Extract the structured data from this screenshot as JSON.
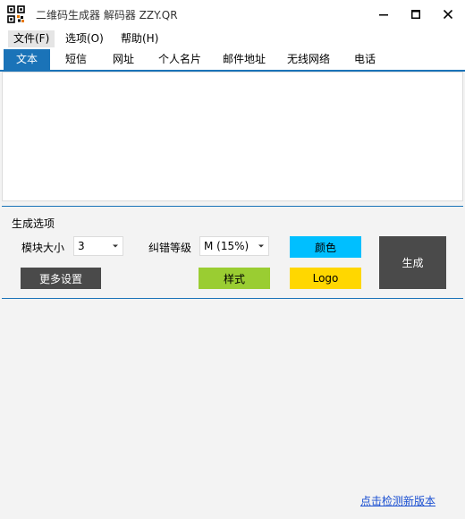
{
  "window": {
    "title": "二维码生成器 解码器 ZZY.QR"
  },
  "menu": {
    "items": [
      "文件(F)",
      "选项(O)",
      "帮助(H)"
    ]
  },
  "tabs": [
    "文本",
    "短信",
    "网址",
    "个人名片",
    "邮件地址",
    "无线网络",
    "电话"
  ],
  "text_input": {
    "value": ""
  },
  "options": {
    "section_title": "生成选项",
    "module_size_label": "模块大小",
    "module_size_value": "3",
    "error_correction_label": "纠错等级",
    "error_correction_value": "M (15%)",
    "color_button": "颜色",
    "style_button": "样式",
    "logo_button": "Logo",
    "more_settings_button": "更多设置",
    "generate_button": "生成"
  },
  "footer": {
    "update_link": "点击检测新版本"
  },
  "colors": {
    "accent": "#1a73b8",
    "color_button": "#00bfff",
    "style_button": "#9acd32",
    "logo_button": "#ffd700",
    "dark_button": "#4a4a4a"
  }
}
